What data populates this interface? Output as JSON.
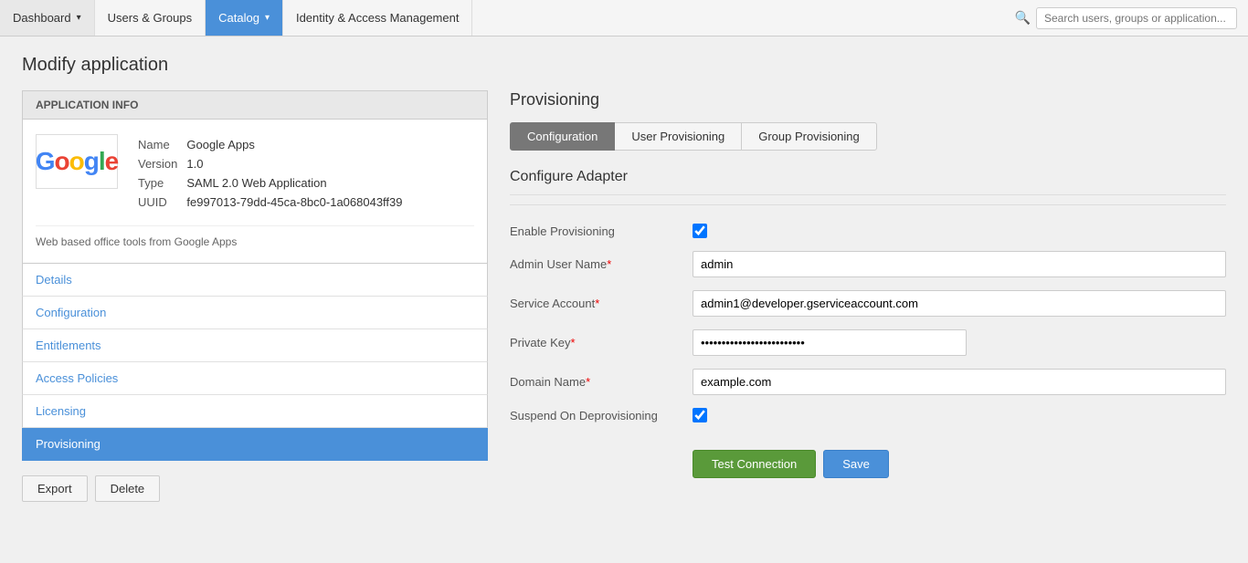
{
  "nav": {
    "items": [
      {
        "label": "Dashboard",
        "hasDropdown": true,
        "active": false
      },
      {
        "label": "Users & Groups",
        "hasDropdown": false,
        "active": false
      },
      {
        "label": "Catalog",
        "hasDropdown": true,
        "active": true
      },
      {
        "label": "Identity & Access Management",
        "hasDropdown": false,
        "active": false
      }
    ],
    "search_placeholder": "Search users, groups or application..."
  },
  "page": {
    "title": "Modify application"
  },
  "app_info": {
    "header": "APPLICATION INFO",
    "logo_text": "Google",
    "name_label": "Name",
    "name_value": "Google Apps",
    "version_label": "Version",
    "version_value": "1.0",
    "type_label": "Type",
    "type_value": "SAML 2.0 Web Application",
    "uuid_label": "UUID",
    "uuid_value": "fe997013-79dd-45ca-8bc0-1a068043ff39",
    "description": "Web based office tools from Google Apps"
  },
  "left_nav": {
    "items": [
      {
        "label": "Details",
        "active": false
      },
      {
        "label": "Configuration",
        "active": false
      },
      {
        "label": "Entitlements",
        "active": false
      },
      {
        "label": "Access Policies",
        "active": false
      },
      {
        "label": "Licensing",
        "active": false
      },
      {
        "label": "Provisioning",
        "active": true
      }
    ]
  },
  "bottom_buttons": {
    "export": "Export",
    "delete": "Delete"
  },
  "provisioning": {
    "title": "Provisioning",
    "tabs": [
      {
        "label": "Configuration",
        "active": true
      },
      {
        "label": "User Provisioning",
        "active": false
      },
      {
        "label": "Group Provisioning",
        "active": false
      }
    ],
    "configure_title": "Configure Adapter",
    "fields": [
      {
        "label": "Enable Provisioning",
        "type": "checkbox",
        "checked": true,
        "required": false,
        "name": "enableProvisioning"
      },
      {
        "label": "Admin User Name",
        "type": "text",
        "value": "admin",
        "required": true,
        "name": "adminUserName"
      },
      {
        "label": "Service Account",
        "type": "text",
        "value": "admin1@developer.gserviceaccount.com",
        "required": true,
        "name": "serviceAccount"
      },
      {
        "label": "Private Key",
        "type": "password",
        "value": "••••••••••••••••••••••••••",
        "required": true,
        "name": "privateKey"
      },
      {
        "label": "Domain Name",
        "type": "text",
        "value": "example.com",
        "required": true,
        "name": "domainName"
      },
      {
        "label": "Suspend On Deprovisioning",
        "type": "checkbox",
        "checked": true,
        "required": false,
        "name": "suspendOnDeprovisioning"
      }
    ],
    "btn_test": "Test Connection",
    "btn_save": "Save"
  }
}
